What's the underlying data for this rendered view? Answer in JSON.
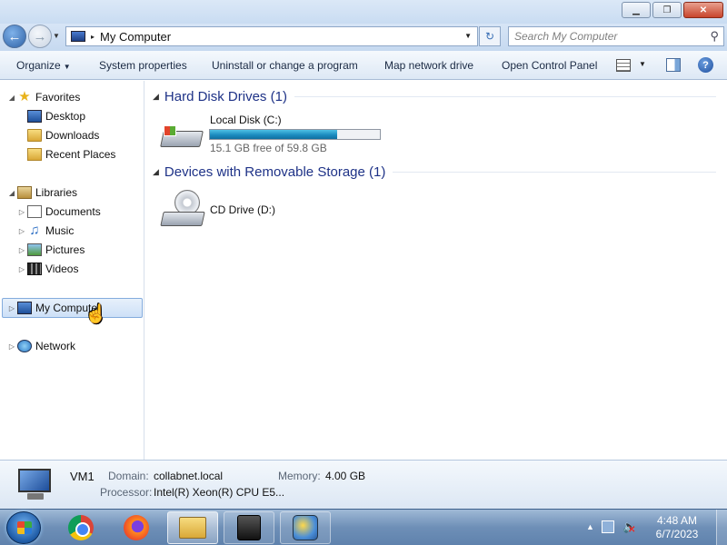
{
  "window": {
    "minimize_glyph": "▁",
    "maximize_glyph": "❐",
    "close_glyph": "✕"
  },
  "address": {
    "path": "My Computer",
    "separator": "▸",
    "search_placeholder": "Search My Computer",
    "refresh_glyph": "↻"
  },
  "toolbar": {
    "organize": "Organize",
    "system_properties": "System properties",
    "uninstall": "Uninstall or change a program",
    "map_drive": "Map network drive",
    "control_panel": "Open Control Panel",
    "help": "?"
  },
  "navpane": {
    "favorites": "Favorites",
    "desktop": "Desktop",
    "downloads": "Downloads",
    "recent_places": "Recent Places",
    "libraries": "Libraries",
    "documents": "Documents",
    "music": "Music",
    "pictures": "Pictures",
    "videos": "Videos",
    "computer": "My Computer",
    "network": "Network",
    "selected": "My Computer"
  },
  "content": {
    "groups": [
      {
        "title": "Hard Disk Drives (1)",
        "drives": [
          {
            "name": "Local Disk (C:)",
            "free_text": "15.1 GB free of 59.8 GB",
            "used_fraction": 0.7475,
            "icon": "hard-disk-icon"
          }
        ]
      },
      {
        "title": "Devices with Removable Storage (1)",
        "drives": [
          {
            "name": "CD Drive (D:)",
            "icon": "cd-drive-icon"
          }
        ]
      }
    ]
  },
  "details": {
    "name": "VM1",
    "domain_label": "Domain:",
    "domain_value": "collabnet.local",
    "memory_label": "Memory:",
    "memory_value": "4.00 GB",
    "processor_label": "Processor:",
    "processor_value": "Intel(R) Xeon(R) CPU E5..."
  },
  "taskbar": {
    "apps": [
      "Google Chrome",
      "Firefox",
      "Windows Explorer",
      "Media",
      "Application"
    ],
    "clock_time": "4:48 AM",
    "clock_date": "6/7/2023"
  },
  "colors": {
    "accent": "#1e3287",
    "progress": "#1c8cc0",
    "selection": "#cde0f7"
  }
}
